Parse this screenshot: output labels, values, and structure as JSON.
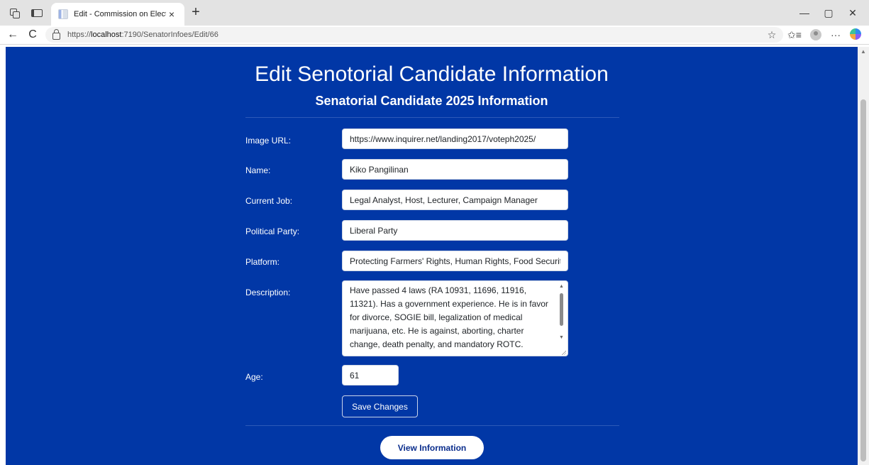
{
  "browser": {
    "tab_title": "Edit - Commission on Elections",
    "tab_close": "×",
    "new_tab": "+",
    "url_scheme": "https://",
    "url_host": "localhost",
    "url_rest": ":7190/SenatorInfoes/Edit/66",
    "icons": {
      "workspaces": "workspaces-icon",
      "tab_actions": "tab-actions-icon",
      "back": "←",
      "refresh": "C",
      "favorite": "☆",
      "favorites_bar": "✩≡",
      "more": "···",
      "minimize": "—",
      "maximize": "▢",
      "close": "✕"
    }
  },
  "page": {
    "title": "Edit Senotorial Candidate Information",
    "subtitle": "Senatorial Candidate 2025 Information"
  },
  "form": {
    "image_url": {
      "label": "Image URL:",
      "value": "https://www.inquirer.net/landing2017/voteph2025/"
    },
    "name": {
      "label": "Name:",
      "value": "Kiko Pangilinan"
    },
    "current_job": {
      "label": "Current Job:",
      "value": "Legal Analyst, Host, Lecturer, Campaign Manager"
    },
    "political_party": {
      "label": "Political Party:",
      "value": "Liberal Party"
    },
    "platform": {
      "label": "Platform:",
      "value": "Protecting Farmers' Rights, Human Rights, Food Security"
    },
    "description": {
      "label": "Description:",
      "value": "Have passed 4 laws (RA 10931, 11696, 11916, 11321). Has a government experience. He is in favor for divorce, SOGIE bill, legalization of medical marijuana, etc. He is against, aborting, charter change, death penalty, and mandatory ROTC."
    },
    "age": {
      "label": "Age:",
      "value": "61"
    },
    "save_label": "Save Changes"
  },
  "footer": {
    "view_label": "View Information"
  }
}
